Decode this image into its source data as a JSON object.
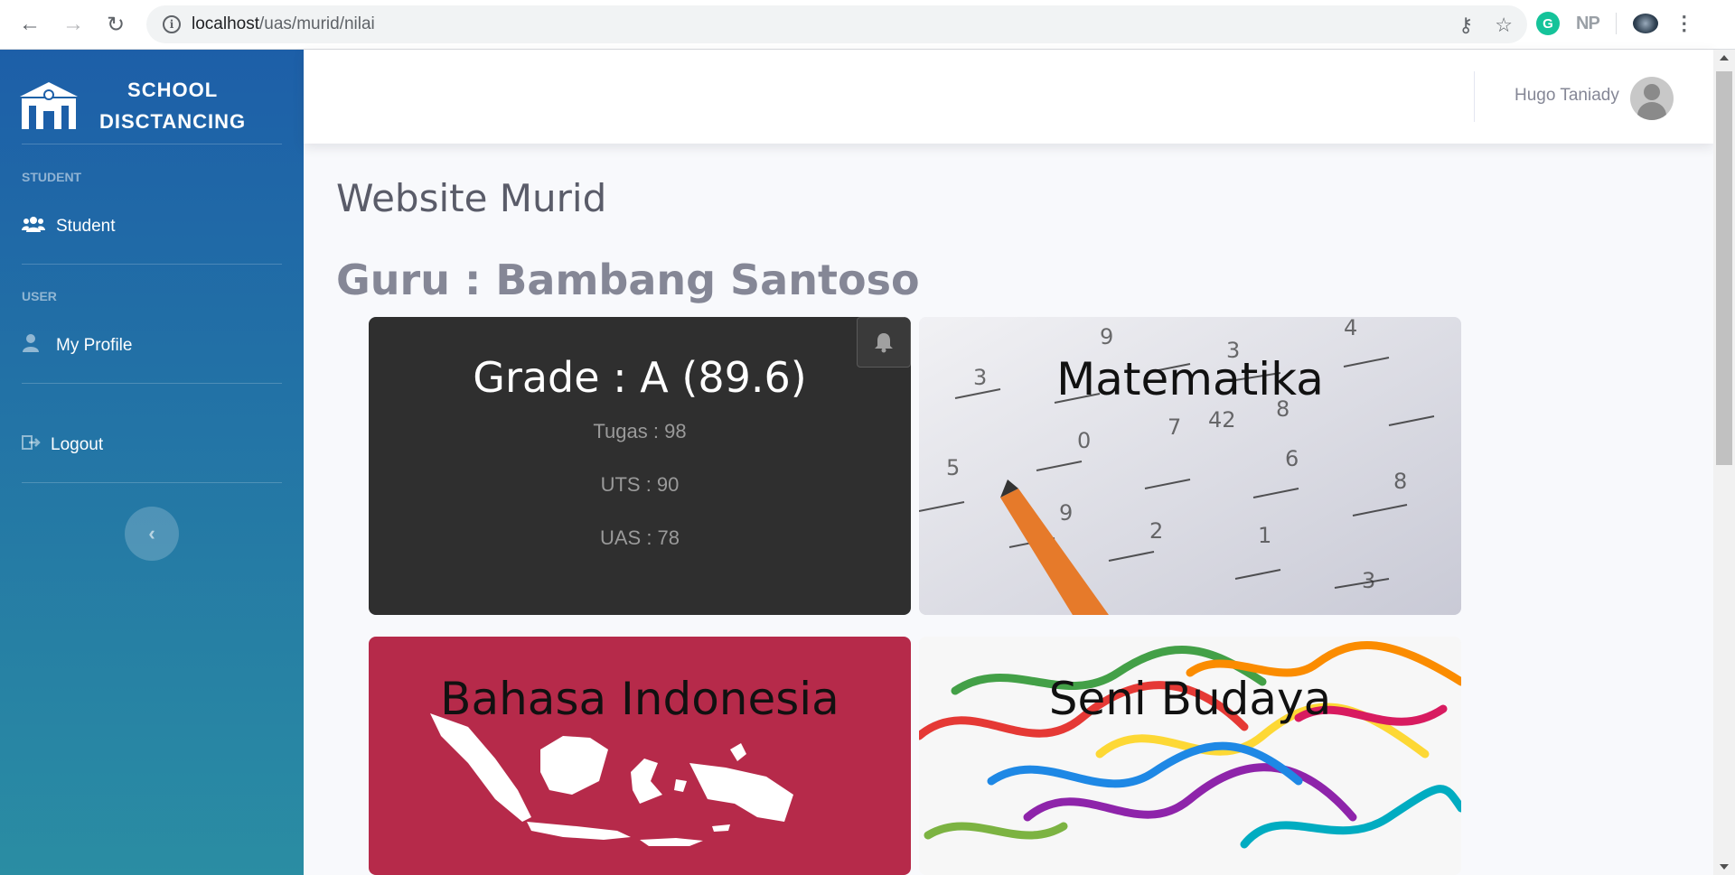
{
  "browser": {
    "url_host": "localhost",
    "url_path": "/uas/murid/nilai",
    "ext_np": "NP",
    "ext_g": "G"
  },
  "sidebar": {
    "brand_line1": "SCHOOL",
    "brand_line2": "DISCTANCING",
    "heading_student": "STUDENT",
    "item_student": "Student",
    "heading_user": "USER",
    "item_profile": "My Profile",
    "item_logout": "Logout"
  },
  "topbar": {
    "user_name": "Hugo Taniady"
  },
  "main": {
    "title": "Website Murid",
    "guru": "Guru : Bambang Santoso"
  },
  "grade_card": {
    "title": "Grade : A (89.6)",
    "tugas": "Tugas : 98",
    "uts": "UTS : 90",
    "uas": "UAS : 78"
  },
  "subjects": [
    {
      "name": "Matematika"
    },
    {
      "name": "Bahasa Indonesia"
    },
    {
      "name": "Seni Budaya"
    }
  ],
  "colors": {
    "sidebar_top": "#1d5fa8",
    "sidebar_bottom": "#2a8da3",
    "grade_card": "#2f2f2f",
    "bahasa_card": "#b62a4a"
  }
}
